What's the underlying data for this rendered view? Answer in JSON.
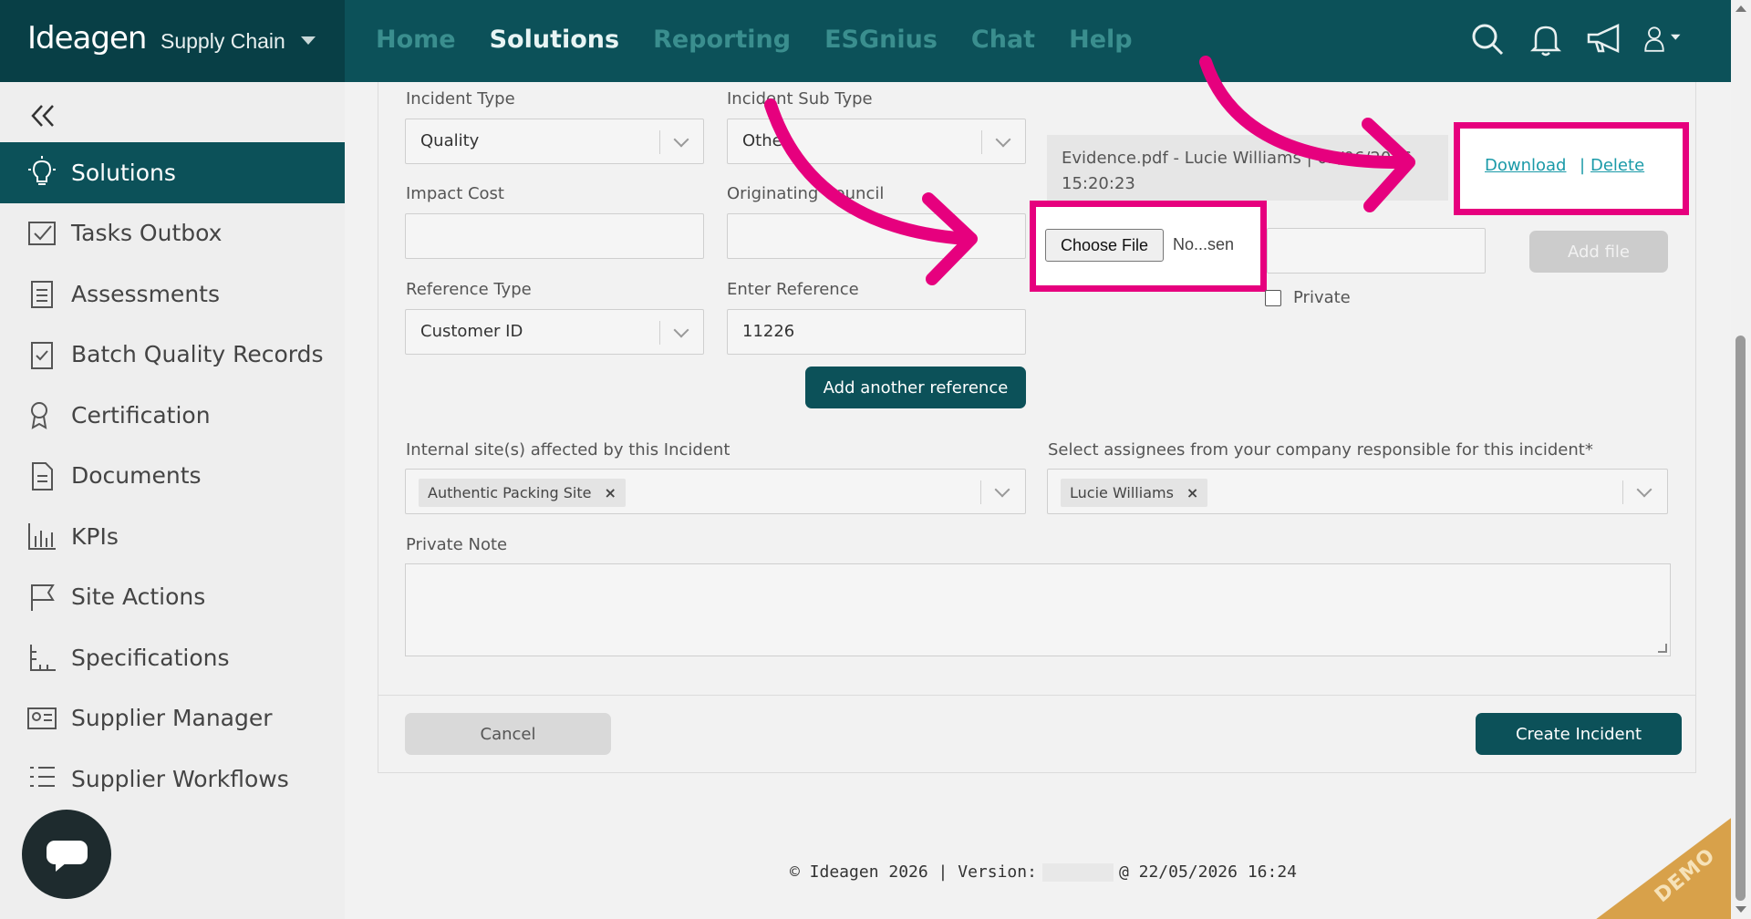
{
  "brand": {
    "logo": "Ideagen",
    "product": "Supply Chain"
  },
  "nav": [
    "Home",
    "Solutions",
    "Reporting",
    "ESGnius",
    "Chat",
    "Help"
  ],
  "nav_active": "Solutions",
  "top_icons": [
    "search-icon",
    "bell-icon",
    "megaphone-icon",
    "user-icon"
  ],
  "sidebar": {
    "items": [
      {
        "label": "Solutions",
        "icon": "lightbulb-icon",
        "active": true
      },
      {
        "label": "Tasks Outbox",
        "icon": "outbox-icon"
      },
      {
        "label": "Assessments",
        "icon": "clipboard-icon"
      },
      {
        "label": "Batch Quality Records",
        "icon": "clipboard-check-icon"
      },
      {
        "label": "Certification",
        "icon": "certificate-icon"
      },
      {
        "label": "Documents",
        "icon": "document-icon"
      },
      {
        "label": "KPIs",
        "icon": "bar-chart-icon"
      },
      {
        "label": "Site Actions",
        "icon": "flag-icon"
      },
      {
        "label": "Specifications",
        "icon": "ruler-icon"
      },
      {
        "label": "Supplier Manager",
        "icon": "id-card-icon"
      },
      {
        "label": "Supplier Workflows",
        "icon": "list-icon"
      }
    ]
  },
  "form": {
    "incident_type": {
      "label": "Incident Type",
      "value": "Quality"
    },
    "incident_sub_type": {
      "label": "Incident Sub Type",
      "value": "Other"
    },
    "impact_cost": {
      "label": "Impact Cost",
      "value": ""
    },
    "originating_council": {
      "label": "Originating Council",
      "value": ""
    },
    "reference_type": {
      "label": "Reference Type",
      "value": "Customer ID"
    },
    "enter_reference": {
      "label": "Enter Reference",
      "value": "11226"
    },
    "add_reference_label": "Add another reference",
    "internal_sites": {
      "label": "Internal site(s) affected by this Incident",
      "tags": [
        "Authentic Packing Site"
      ]
    },
    "assignees": {
      "label": "Select assignees from your company responsible for this incident*",
      "tags": [
        "Lucie Williams"
      ]
    },
    "private_note": {
      "label": "Private Note",
      "value": ""
    },
    "cancel_label": "Cancel",
    "create_label": "Create Incident"
  },
  "attachment": {
    "file_line1": "Evidence.pdf - Lucie Williams | 02/06/2026",
    "file_line2": "15:20:23",
    "download_label": "Download",
    "separator": "|",
    "delete_label": "Delete",
    "choose_file_label": "Choose File",
    "no_file_text": "No...sen",
    "add_file_label": "Add file",
    "private_label": "Private"
  },
  "footer": {
    "prefix": "© Ideagen 2026 | Version:",
    "suffix": "@ 22/05/2026 16:24"
  },
  "demo_badge": "DEMO",
  "colors": {
    "brand": "#0c5159",
    "highlight": "#e6007e",
    "link": "#1a9aa8"
  }
}
